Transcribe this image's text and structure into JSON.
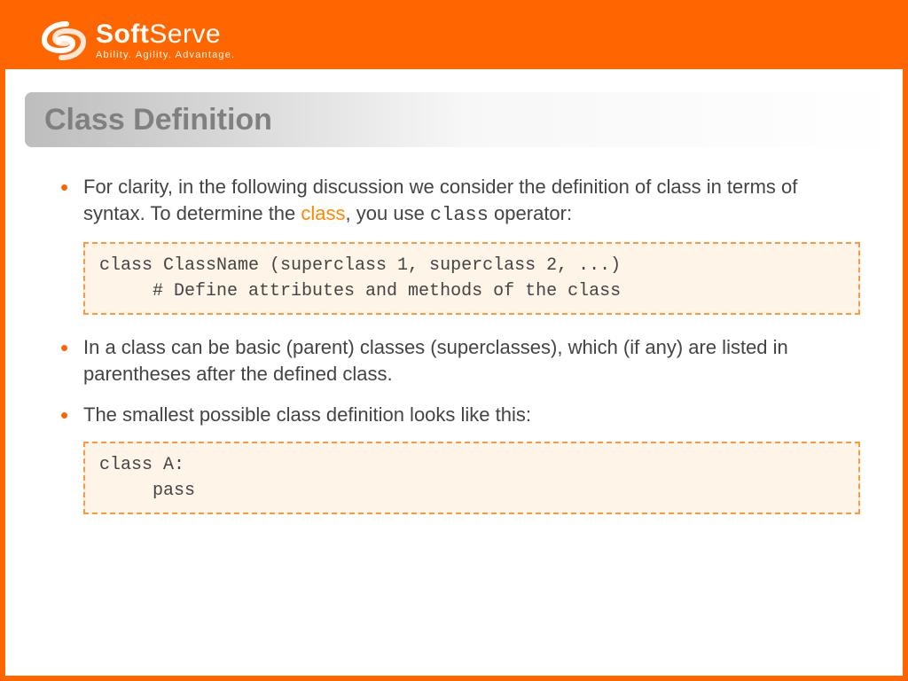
{
  "brand": {
    "name_bold": "Soft",
    "name_light": "Serve",
    "tagline": "Ability. Agility. Advantage."
  },
  "title": "Class Definition",
  "bullets": {
    "b1_pre": "For clarity, in the following discussion we consider the definition of class in terms of syntax. To determine the ",
    "b1_orange": "class",
    "b1_mid": ", you use ",
    "b1_mono": "class",
    "b1_post": " operator:",
    "b2": "In a class can be basic (parent) classes (superclasses), which (if any) are listed in parentheses after the defined class.",
    "b3": "The smallest possible class definition looks like this:"
  },
  "code": {
    "block1": "class ClassName (superclass 1, superclass 2, ...)\n     # Define attributes and methods of the class",
    "block2": "class A:\n     pass"
  }
}
